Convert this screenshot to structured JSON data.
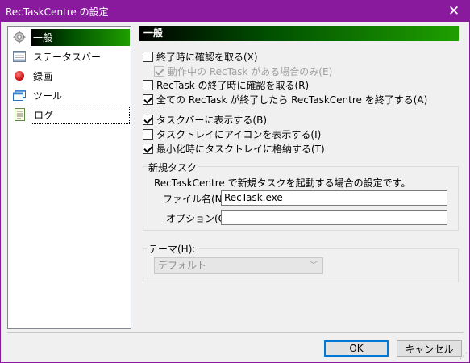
{
  "window": {
    "title": "RecTaskCentre の設定"
  },
  "nav": {
    "items": [
      {
        "label": "一般",
        "icon": "gear-icon"
      },
      {
        "label": "ステータスバー",
        "icon": "status-bar-icon"
      },
      {
        "label": "録画",
        "icon": "record-icon"
      },
      {
        "label": "ツール",
        "icon": "window-icon"
      },
      {
        "label": "ログ",
        "icon": "log-icon"
      }
    ],
    "selected": "一般",
    "focused": "ログ"
  },
  "general": {
    "header": "一般",
    "options": {
      "confirm_exit": "終了時に確認を取る(X)",
      "only_when_running": "動作中の RecTask がある場合のみ(E)",
      "confirm_rectask_exit": "RecTask の終了時に確認を取る(R)",
      "exit_when_all_done": "全ての RecTask が終了したら RecTaskCentre を終了する(A)",
      "show_in_taskbar": "タスクバーに表示する(B)",
      "show_tray_icon": "タスクトレイにアイコンを表示する(I)",
      "minimize_to_tray": "最小化時にタスクトレイに格納する(T)"
    },
    "new_task": {
      "legend": "新規タスク",
      "description": "RecTaskCentre で新規タスクを起動する場合の設定です。",
      "file_label": "ファイル名(N):",
      "file_value": "RecTask.exe",
      "option_label": "オプション(O):",
      "option_value": ""
    },
    "theme": {
      "legend": "テーマ(H):",
      "selected": "デフォルト"
    }
  },
  "buttons": {
    "ok": "OK",
    "cancel": "キャンセル"
  }
}
